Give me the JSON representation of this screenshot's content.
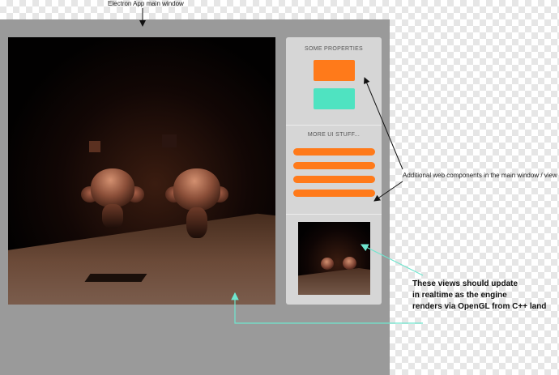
{
  "window_label": "Electron App main window",
  "sidebar": {
    "section1_title": "SOME PROPERTIES",
    "section2_title": "MORE UI STUFF...",
    "swatch_orange": "#ff7a1a",
    "swatch_teal": "#4fe3c1",
    "bars_count_color": "#ff7a1a"
  },
  "annotations": {
    "web_components": "Additional web components in the main window / view",
    "realtime_lines": [
      "These views should update",
      "in realtime as the engine",
      "renders via OpenGL from C++ land"
    ]
  },
  "colors": {
    "window_bg": "#9a9a9a",
    "sidebar_bg": "#d6d6d6",
    "annotation_line": "#6fe6cf"
  }
}
